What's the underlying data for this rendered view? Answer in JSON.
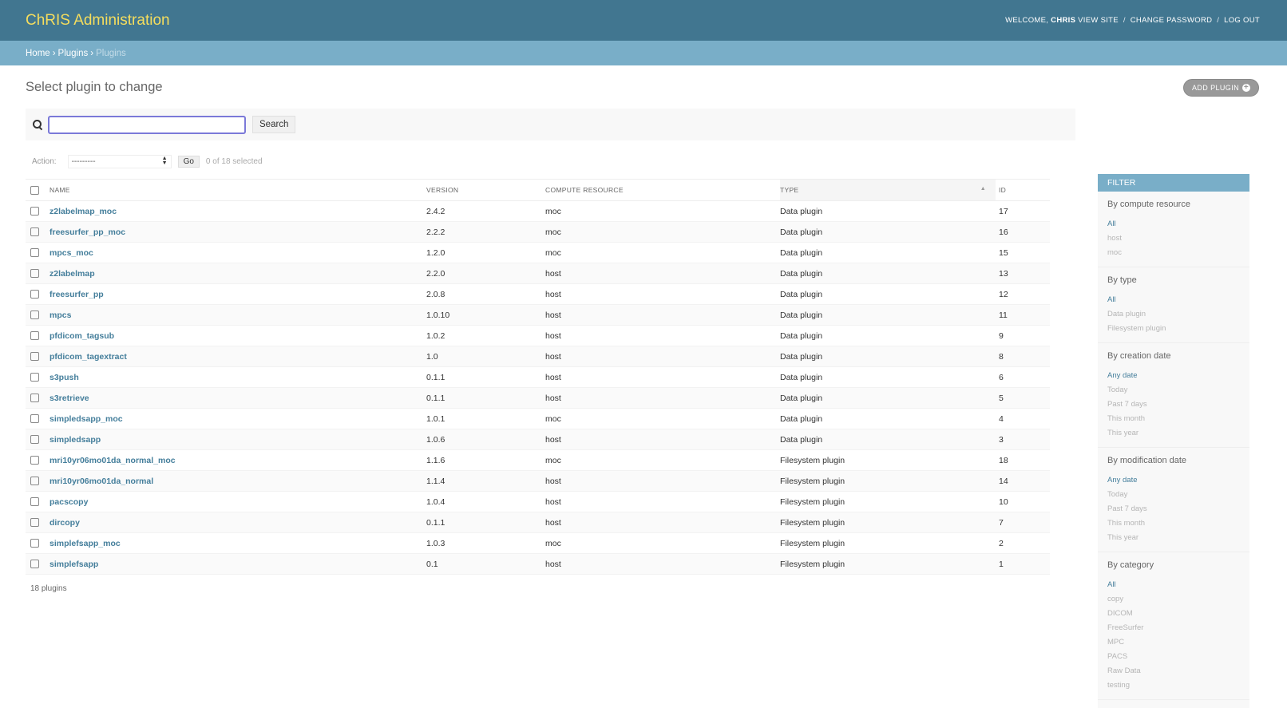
{
  "header": {
    "title": "ChRIS Administration",
    "welcome": "Welcome,",
    "username": "chris",
    "view_site": "View site",
    "change_password": "Change password",
    "log_out": "Log out",
    "sep": "/"
  },
  "breadcrumbs": {
    "home": "Home",
    "plugins": "Plugins",
    "current": "Plugins",
    "sep": "›"
  },
  "page": {
    "title": "Select plugin to change",
    "add_button": "Add plugin"
  },
  "search": {
    "value": "",
    "button": "Search"
  },
  "actions": {
    "label": "Action:",
    "selected_option": "---------",
    "go": "Go",
    "count": "0 of 18 selected"
  },
  "table": {
    "headers": {
      "name": "Name",
      "version": "Version",
      "compute_resource": "Compute resource",
      "type": "Type",
      "id": "ID"
    },
    "rows": [
      {
        "name": "z2labelmap_moc",
        "version": "2.4.2",
        "compute": "moc",
        "type": "Data plugin",
        "id": "17"
      },
      {
        "name": "freesurfer_pp_moc",
        "version": "2.2.2",
        "compute": "moc",
        "type": "Data plugin",
        "id": "16"
      },
      {
        "name": "mpcs_moc",
        "version": "1.2.0",
        "compute": "moc",
        "type": "Data plugin",
        "id": "15"
      },
      {
        "name": "z2labelmap",
        "version": "2.2.0",
        "compute": "host",
        "type": "Data plugin",
        "id": "13"
      },
      {
        "name": "freesurfer_pp",
        "version": "2.0.8",
        "compute": "host",
        "type": "Data plugin",
        "id": "12"
      },
      {
        "name": "mpcs",
        "version": "1.0.10",
        "compute": "host",
        "type": "Data plugin",
        "id": "11"
      },
      {
        "name": "pfdicom_tagsub",
        "version": "1.0.2",
        "compute": "host",
        "type": "Data plugin",
        "id": "9"
      },
      {
        "name": "pfdicom_tagextract",
        "version": "1.0",
        "compute": "host",
        "type": "Data plugin",
        "id": "8"
      },
      {
        "name": "s3push",
        "version": "0.1.1",
        "compute": "host",
        "type": "Data plugin",
        "id": "6"
      },
      {
        "name": "s3retrieve",
        "version": "0.1.1",
        "compute": "host",
        "type": "Data plugin",
        "id": "5"
      },
      {
        "name": "simpledsapp_moc",
        "version": "1.0.1",
        "compute": "moc",
        "type": "Data plugin",
        "id": "4"
      },
      {
        "name": "simpledsapp",
        "version": "1.0.6",
        "compute": "host",
        "type": "Data plugin",
        "id": "3"
      },
      {
        "name": "mri10yr06mo01da_normal_moc",
        "version": "1.1.6",
        "compute": "moc",
        "type": "Filesystem plugin",
        "id": "18"
      },
      {
        "name": "mri10yr06mo01da_normal",
        "version": "1.1.4",
        "compute": "host",
        "type": "Filesystem plugin",
        "id": "14"
      },
      {
        "name": "pacscopy",
        "version": "1.0.4",
        "compute": "host",
        "type": "Filesystem plugin",
        "id": "10"
      },
      {
        "name": "dircopy",
        "version": "0.1.1",
        "compute": "host",
        "type": "Filesystem plugin",
        "id": "7"
      },
      {
        "name": "simplefsapp_moc",
        "version": "1.0.3",
        "compute": "moc",
        "type": "Filesystem plugin",
        "id": "2"
      },
      {
        "name": "simplefsapp",
        "version": "0.1",
        "compute": "host",
        "type": "Filesystem plugin",
        "id": "1"
      }
    ]
  },
  "paginator": "18 plugins",
  "filter": {
    "title": "Filter",
    "sections": [
      {
        "title": "By compute resource",
        "items": [
          "All",
          "host",
          "moc"
        ]
      },
      {
        "title": "By type",
        "items": [
          "All",
          "Data plugin",
          "Filesystem plugin"
        ]
      },
      {
        "title": "By creation date",
        "items": [
          "Any date",
          "Today",
          "Past 7 days",
          "This month",
          "This year"
        ]
      },
      {
        "title": "By modification date",
        "items": [
          "Any date",
          "Today",
          "Past 7 days",
          "This month",
          "This year"
        ]
      },
      {
        "title": "By category",
        "items": [
          "All",
          "copy",
          "DICOM",
          "FreeSurfer",
          "MPC",
          "PACS",
          "Raw Data",
          "testing"
        ]
      }
    ]
  }
}
